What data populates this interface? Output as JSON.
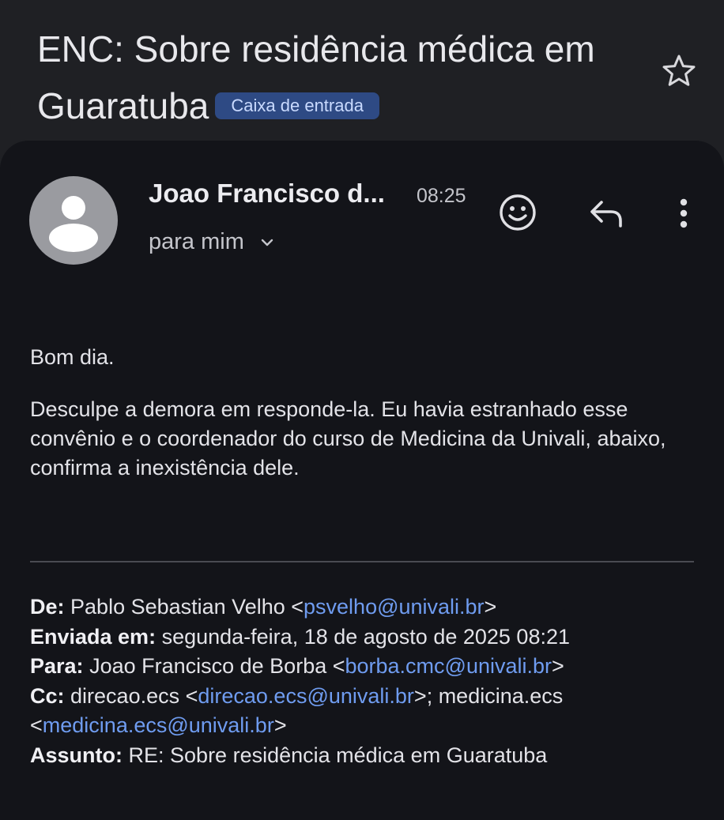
{
  "subject": {
    "title": "ENC: Sobre residência médica em Guaratuba",
    "label_badge": "Caixa de entrada"
  },
  "icons": {
    "star": "star-outline-icon",
    "emoji": "emoji-reaction-icon",
    "reply": "reply-icon",
    "more": "more-vert-icon",
    "expand": "chevron-down-icon",
    "avatar": "default-person-avatar"
  },
  "message": {
    "sender_name": "Joao Francisco d...",
    "time": "08:25",
    "recipient": "para mim",
    "greeting": "Bom dia.",
    "paragraph": "Desculpe a demora em responde-la. Eu havia estranhado esse convênio e o coordenador do curso de Medicina da Univali, abaixo, confirma a inexistência dele."
  },
  "forwarded": {
    "from_label": "De:",
    "from_name": "Pablo Sebastian Velho <",
    "from_email": "psvelho@univali.br",
    "from_end": ">",
    "sent_label": "Enviada em:",
    "sent_value": "segunda-feira, 18 de agosto de 2025 08:21",
    "to_label": "Para:",
    "to_name": "Joao Francisco de Borba <",
    "to_email": "borba.cmc@univali.br",
    "to_end": ">",
    "cc_label": "Cc:",
    "cc_name1": "direcao.ecs <",
    "cc_email1": "direcao.ecs@univali.br",
    "cc_mid": ">; medicina.ecs",
    "cc_open2": "<",
    "cc_email2": "medicina.ecs@univali.br",
    "cc_end2": ">",
    "subject_label": "Assunto:",
    "subject_value": "RE: Sobre residência médica em Guaratuba"
  },
  "colors": {
    "background": "#1f2024",
    "card": "#131419",
    "badge_bg": "#2e4a84",
    "badge_text": "#c9daff",
    "link": "#6f9cf0"
  }
}
